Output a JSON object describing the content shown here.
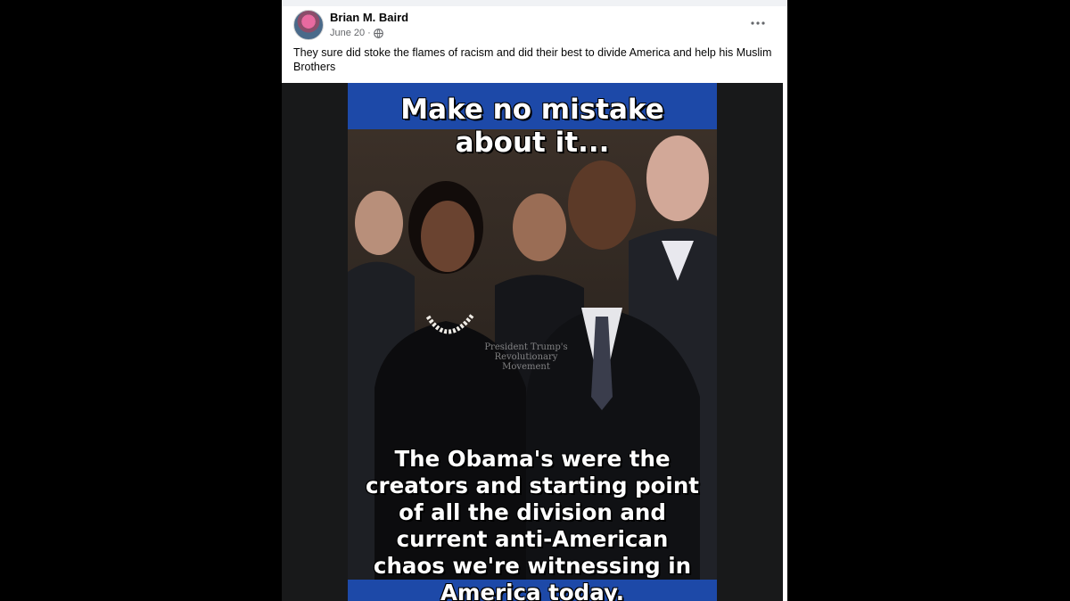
{
  "post": {
    "author": "Brian M. Baird",
    "date": "June 20",
    "separator": "·",
    "audience_icon": "globe-icon",
    "more_icon": "more-options-icon",
    "caption": "They sure did stoke the flames of racism and did their best to divide America and help his Muslim Brothers"
  },
  "meme": {
    "headline": "Make no mistake\nabout it...",
    "body": "The Obama's were the\ncreators and starting point\nof all the division and\ncurrent anti-American\nchaos we're witnessing in\nAmerica today.",
    "watermark": "President Trump's\nRevolutionary\nMovement",
    "colors": {
      "band": "#1d49a8",
      "text": "#ffffff"
    }
  }
}
